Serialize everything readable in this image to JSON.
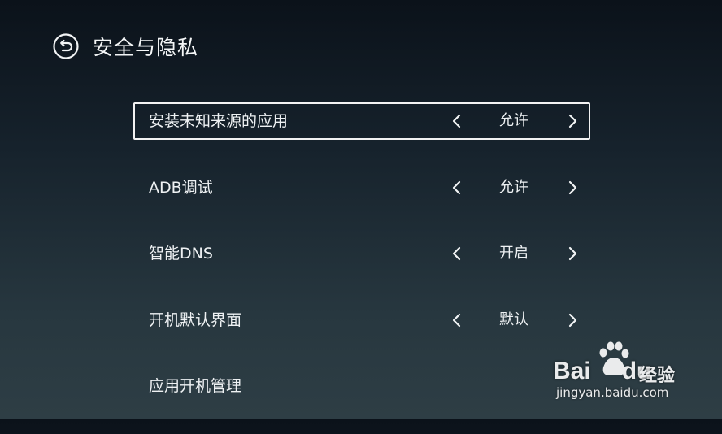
{
  "header": {
    "title": "安全与隐私",
    "back_icon": "back-arrow-circle-icon"
  },
  "settings": [
    {
      "label": "安装未知来源的应用",
      "value": "允许",
      "focused": true
    },
    {
      "label": "ADB调试",
      "value": "允许",
      "focused": false
    },
    {
      "label": "智能DNS",
      "value": "开启",
      "focused": false
    },
    {
      "label": "开机默认界面",
      "value": "默认",
      "focused": false
    },
    {
      "label": "应用开机管理",
      "value": "",
      "focused": false
    }
  ],
  "icons": {
    "prev": "chevron-left-icon",
    "next": "chevron-right-icon"
  },
  "colors": {
    "text": "#f2f4f5",
    "focus_border": "#f2f2f2",
    "background_top": "#0b121a",
    "background_bottom": "#2e3e45"
  },
  "watermark": {
    "brand": "Bai",
    "brand_suffix": "du",
    "product": "经验",
    "url": "jingyan.baidu.com"
  }
}
